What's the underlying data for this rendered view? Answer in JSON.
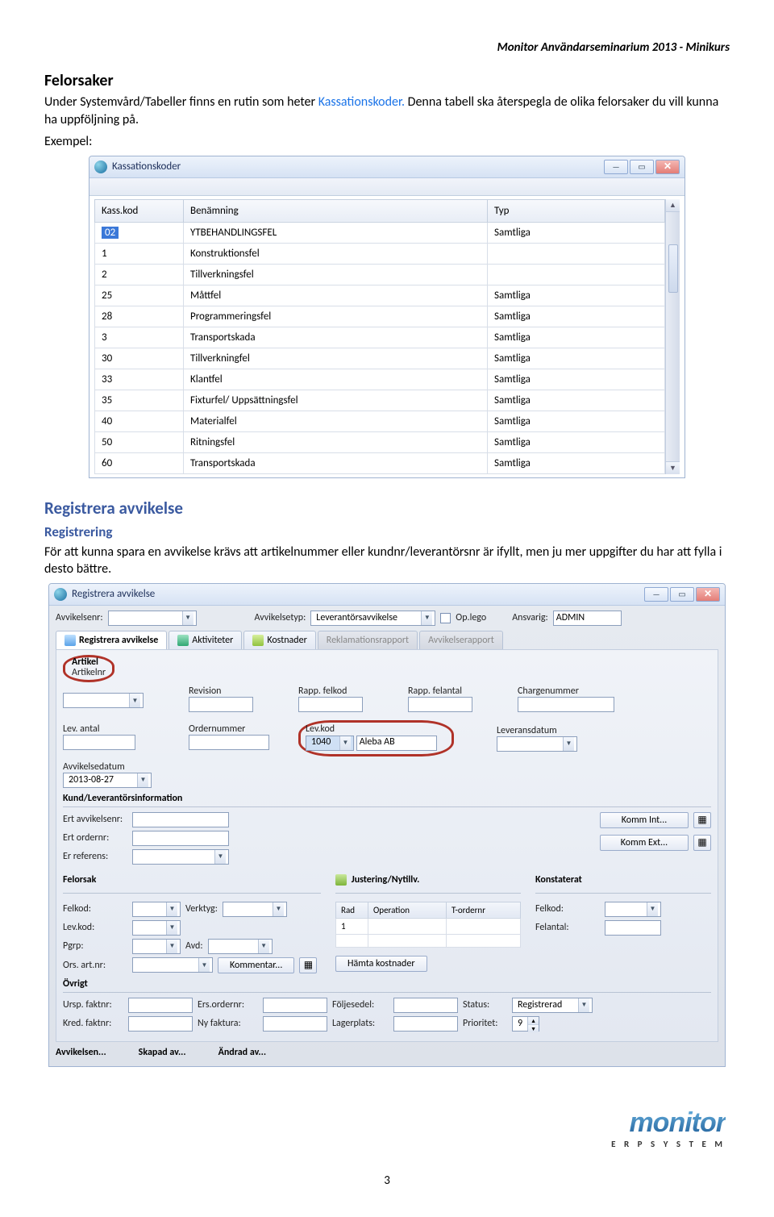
{
  "doc_header": "Monitor Användarseminarium 2013 - Minikurs",
  "sections": {
    "felorsaker_title": "Felorsaker",
    "felorsaker_p1a": "Under Systemvård/Tabeller finns en rutin som heter ",
    "felorsaker_link": "Kassationskoder.",
    "felorsaker_p1b": " Denna tabell ska återspegla de olika felorsaker du vill kunna ha uppföljning på.",
    "exempel": "Exempel:",
    "registrera_title": "Registrera avvikelse",
    "registrering_title": "Registrering",
    "registrering_p": "För att kunna spara en avvikelse krävs att artikelnummer eller kundnr/leverantörsnr är ifyllt, men ju mer uppgifter du har att fylla i desto bättre."
  },
  "win1": {
    "title": "Kassationskoder",
    "columns": [
      "Kass.kod",
      "Benämning",
      "Typ"
    ],
    "rows": [
      {
        "kod": "02",
        "ben": "YTBEHANDLINGSFEL",
        "typ": "Samtliga",
        "sel": true
      },
      {
        "kod": "1",
        "ben": "Konstruktionsfel",
        "typ": ""
      },
      {
        "kod": "2",
        "ben": "Tillverkningsfel",
        "typ": ""
      },
      {
        "kod": "25",
        "ben": "Måttfel",
        "typ": "Samtliga"
      },
      {
        "kod": "28",
        "ben": "Programmeringsfel",
        "typ": "Samtliga"
      },
      {
        "kod": "3",
        "ben": "Transportskada",
        "typ": "Samtliga"
      },
      {
        "kod": "30",
        "ben": "Tillverkningfel",
        "typ": "Samtliga"
      },
      {
        "kod": "33",
        "ben": "Klantfel",
        "typ": "Samtliga"
      },
      {
        "kod": "35",
        "ben": "Fixturfel/ Uppsättningsfel",
        "typ": "Samtliga"
      },
      {
        "kod": "40",
        "ben": "Materialfel",
        "typ": "Samtliga"
      },
      {
        "kod": "50",
        "ben": "Ritningsfel",
        "typ": "Samtliga"
      },
      {
        "kod": "60",
        "ben": "Transportskada",
        "typ": "Samtliga"
      }
    ]
  },
  "win2": {
    "title": "Registrera avvikelse",
    "top": {
      "avvikelsenr_lbl": "Avvikelsenr:",
      "avvikelsetyp_lbl": "Avvikelsetyp:",
      "avvikelsetyp_val": "Leverantörsavvikelse",
      "oplego_lbl": "Op.lego",
      "ansvarig_lbl": "Ansvarig:",
      "ansvarig_val": "ADMIN"
    },
    "tabs": {
      "reg": "Registrera avvikelse",
      "akt": "Aktiviteter",
      "kost": "Kostnader",
      "rekl": "Reklamationsrapport",
      "avr": "Avvikelserapport"
    },
    "artikel": {
      "title": "Artikel",
      "artikelnr_lbl": "Artikelnr",
      "revision_lbl": "Revision",
      "rapp_felkod_lbl": "Rapp. felkod",
      "rapp_felantal_lbl": "Rapp. felantal",
      "chargenummer_lbl": "Chargenummer",
      "lev_antal_lbl": "Lev. antal",
      "ordernummer_lbl": "Ordernummer",
      "lev_kod_lbl": "Lev.kod",
      "lev_kod_val": "1040",
      "lev_kod_name": "Aleba AB",
      "leveransdatum_lbl": "Leveransdatum",
      "avvikelsedatum_lbl": "Avvikelsedatum",
      "avvikelsedatum_val": "2013-08-27"
    },
    "kund": {
      "title": "Kund/Leverantörsinformation",
      "ert_avvikelsenr": "Ert avvikelsenr:",
      "ert_ordernr": "Ert ordernr:",
      "er_referens": "Er referens:",
      "komm_int": "Komm Int...",
      "komm_ext": "Komm Ext..."
    },
    "felorsak": {
      "title": "Felorsak",
      "just_title": "Justering/Nytillv.",
      "konst_title": "Konstaterat",
      "felkod": "Felkod:",
      "verktyg": "Verktyg:",
      "levkod": "Lev.kod:",
      "pgrp": "Pgrp:",
      "avd": "Avd:",
      "ors_artnr": "Ors. art.nr:",
      "kommentar": "Kommentar...",
      "tbl": {
        "rad": "Rad",
        "op": "Operation",
        "tord": "T-ordernr",
        "r1": "1"
      },
      "hamta": "Hämta kostnader",
      "felantal": "Felantal:"
    },
    "ovrigt": {
      "title": "Övrigt",
      "ursp": "Ursp. faktnr:",
      "ersord": "Ers.ordernr:",
      "foljes": "Följesedel:",
      "status_lbl": "Status:",
      "status_val": "Registrerad",
      "kred": "Kred. faktnr:",
      "nyf": "Ny faktura:",
      "lager": "Lagerplats:",
      "prio_lbl": "Prioritet:",
      "prio_val": "9"
    },
    "footer_row": {
      "avv": "Avvikelsen...",
      "skapad": "Skapad av...",
      "andrad": "Ändrad av..."
    }
  },
  "logo": {
    "name": "monitor",
    "sub": "E R P   S Y S T E M"
  },
  "page_number": "3"
}
